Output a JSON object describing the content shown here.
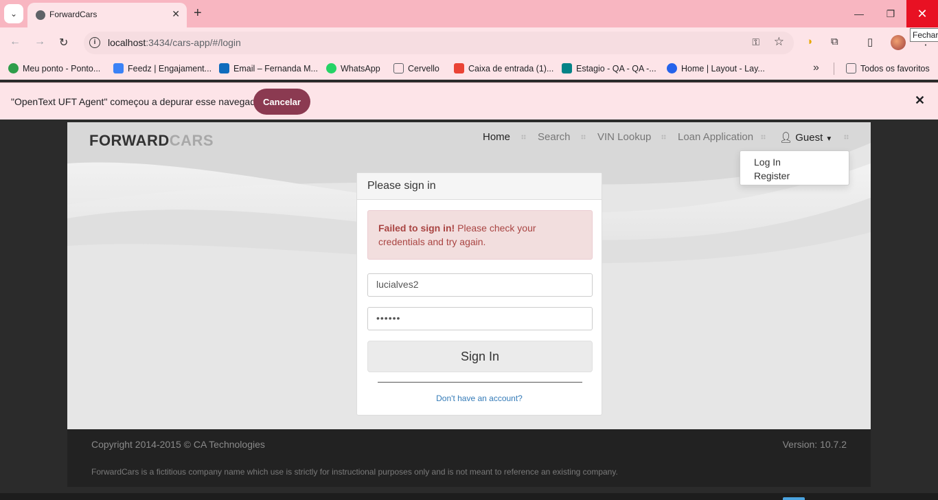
{
  "browser": {
    "tab_title": "ForwardCars",
    "url_host": "localhost",
    "url_rest": ":3434/cars-app/#/login",
    "tooltip": "Fechar",
    "bookmarks": [
      {
        "label": "Meu ponto - Ponto...",
        "color": "#2e9d4a"
      },
      {
        "label": "Feedz | Engajament...",
        "color": "#3b82f6"
      },
      {
        "label": "Email – Fernanda M...",
        "color": "#0f6cbd"
      },
      {
        "label": "WhatsApp",
        "color": "#25d366"
      },
      {
        "label": "Cervello",
        "color": "#5f6368"
      },
      {
        "label": "Caixa de entrada (1)...",
        "color": "#ea4335"
      },
      {
        "label": "Estagio - QA - QA -...",
        "color": "#038387"
      },
      {
        "label": "Home | Layout - Lay...",
        "color": "#2563eb"
      }
    ],
    "all_bookmarks": "Todos os favoritos",
    "infobar": {
      "message": "\"OpenText UFT Agent\" começou a depurar esse navegador",
      "cancel_label": "Cancelar"
    }
  },
  "site": {
    "brand_first": "FORWARD",
    "brand_second": "CARS",
    "nav": {
      "home": "Home",
      "search": "Search",
      "vin": "VIN Lookup",
      "loan": "Loan Application",
      "guest": "Guest"
    },
    "dropdown": {
      "login": "Log In",
      "register": "Register"
    },
    "login": {
      "heading": "Please sign in",
      "alert_strong": "Failed to sign in!",
      "alert_text": " Please check your credentials and try again.",
      "username_value": "lucialves2",
      "password_value": "••••••",
      "button_label": "Sign In",
      "register_link": "Don't have an account?"
    },
    "footer": {
      "copyright": "Copyright 2014-2015 © CA Technologies",
      "version": "Version: 10.7.2",
      "disclaimer": "ForwardCars is a fictitious company name which use is strictly for instructional purposes only and is not meant to reference an existing company."
    }
  }
}
